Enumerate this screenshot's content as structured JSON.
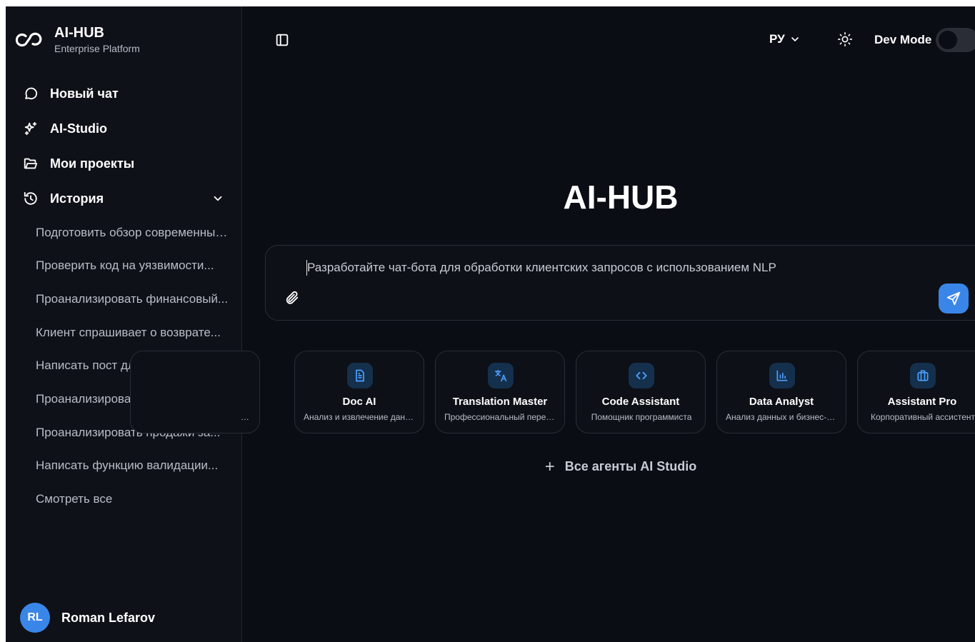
{
  "brand": {
    "title": "AI-HUB",
    "subtitle": "Enterprise Platform"
  },
  "sidebar": {
    "nav": [
      {
        "label": "Новый чат",
        "icon": "chat-bubble-icon"
      },
      {
        "label": "AI-Studio",
        "icon": "sparkles-icon"
      },
      {
        "label": "Мои проекты",
        "icon": "folder-icon"
      },
      {
        "label": "История",
        "icon": "history-icon"
      }
    ],
    "history": [
      "Подготовить обзор современных...",
      "Проверить код на уязвимости...",
      "Проанализировать финансовый...",
      "Клиент спрашивает о возврате...",
      "Написать пост для LinkedIn о...",
      "Проанализировать договор на...",
      "Проанализировать продажи за...",
      "Написать функцию валидации..."
    ],
    "see_all": "Смотреть все"
  },
  "user": {
    "initials": "RL",
    "name": "Roman Lefarov"
  },
  "header": {
    "language": "РУ",
    "dev_mode_label": "Dev Mode",
    "dev_mode_on": false
  },
  "main": {
    "title": "AI-HUB",
    "prompt_text": "Разработайте чат-бота для обработки клиентских запросов с использованием NLP",
    "agents": [
      {
        "name": "Doc AI",
        "desc": "Анализ и извлечение данных из документов",
        "icon": "document-icon"
      },
      {
        "name": "Translation Master",
        "desc": "Профессиональный переводчик",
        "icon": "translate-icon"
      },
      {
        "name": "Code Assistant",
        "desc": "Помощник программиста",
        "icon": "code-icon"
      },
      {
        "name": "Data Analyst",
        "desc": "Анализ данных и бизнес-метрик",
        "icon": "bar-chart-icon"
      },
      {
        "name": "Assistant Pro",
        "desc": "Корпоративный ассистент",
        "icon": "briefcase-icon"
      }
    ],
    "all_agents_label": "Все агенты AI Studio"
  },
  "colors": {
    "accent": "#3a86e8",
    "background": "#0b0d14",
    "sidebar": "#0f1118"
  }
}
